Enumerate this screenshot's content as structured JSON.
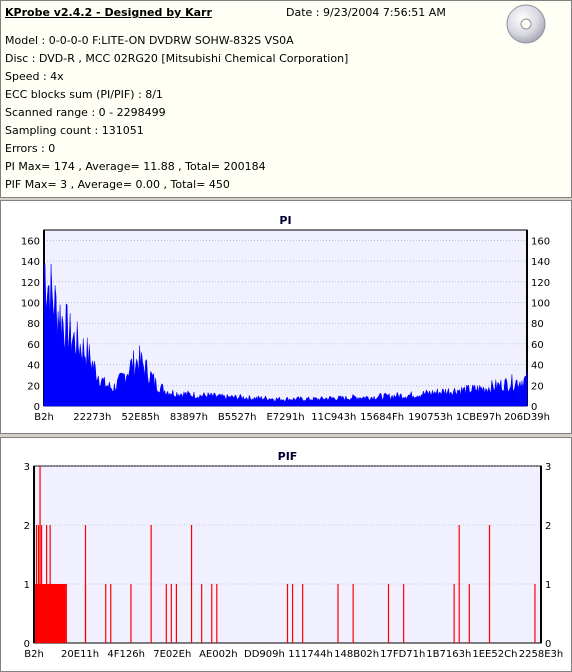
{
  "header": {
    "title": "KProbe v2.4.2 - Designed by Karr",
    "date": "Date : 9/23/2004 7:56:51 AM",
    "lines": [
      "Model : 0-0-0-0 F:LITE-ON DVDRW SOHW-832S  VS0A",
      "Disc : DVD-R , MCC 02RG20  [Mitsubishi Chemical Corporation]",
      "Speed : 4x",
      "ECC blocks sum (PI/PIF) : 8/1",
      "Scanned range : 0 - 2298499",
      "Sampling count : 131051",
      "Errors : 0",
      "PI Max= 174 , Average= 11.88 , Total= 200184",
      "PIF Max= 3 , Average= 0.00 , Total= 450"
    ],
    "icon": "cd-disc-icon"
  },
  "colors": {
    "pi_fill": "#0000ff",
    "pif_bar": "#ff0000",
    "plot_bg": "#f0f0ff",
    "title": "#000033"
  },
  "chart_data": [
    {
      "type": "area",
      "title": "PI",
      "ylim": [
        0,
        170
      ],
      "y_ticks": [
        "0",
        "20",
        "40",
        "60",
        "80",
        "100",
        "120",
        "140",
        "160"
      ],
      "x_ticks": [
        "B2h",
        "22273h",
        "52E85h",
        "83897h",
        "B5527h",
        "E7291h",
        "11C943h",
        "15684Fh",
        "190753h",
        "1CBE97h",
        "206D39h"
      ],
      "x_range_hex": [
        "0",
        "2298499"
      ],
      "envelope_x": [
        "B2h",
        "22273h",
        "52E85h",
        "83897h",
        "B5527h",
        "E7291h",
        "11C943h",
        "15684Fh",
        "190753h",
        "1CBE97h",
        "206D39h",
        "2298499"
      ],
      "envelope_y": [
        160,
        90,
        50,
        14,
        10,
        8,
        9,
        7,
        12,
        17,
        22,
        30
      ],
      "series": [
        {
          "values": [
            160,
            120,
            100,
            80,
            70,
            60,
            40,
            25,
            20,
            30,
            45,
            52,
            40,
            25,
            18,
            15,
            14,
            13,
            12,
            12,
            11,
            10,
            10,
            10,
            9,
            9,
            9,
            8,
            8,
            8,
            8,
            8,
            8,
            9,
            9,
            9,
            10,
            10,
            10,
            11,
            11,
            12,
            12,
            13,
            14,
            15,
            16,
            17,
            18,
            18,
            19,
            20,
            22,
            24,
            26,
            28,
            30
          ]
        }
      ]
    },
    {
      "type": "bar",
      "title": "PIF",
      "ylim": [
        0,
        3
      ],
      "y_ticks": [
        "0",
        "1",
        "2",
        "3"
      ],
      "x_ticks": [
        "B2h",
        "20E11h",
        "4F126h",
        "7E02Eh",
        "AE002h",
        "DD909h",
        "111744h",
        "148B02h",
        "17FD71h",
        "1B7163h",
        "1EE52Ch",
        "2258E3h"
      ],
      "series": [
        {
          "name": "PIF",
          "x_frac": [
            0.003,
            0.007,
            0.01,
            0.013,
            0.017,
            0.02,
            0.023,
            0.027,
            0.03,
            0.033,
            0.036,
            0.04,
            0.043,
            0.046,
            0.05,
            0.053,
            0.056,
            0.06,
            0.062,
            0.1,
            0.1,
            0.14,
            0.15,
            0.19,
            0.23,
            0.26,
            0.27,
            0.28,
            0.31,
            0.33,
            0.35,
            0.36,
            0.5,
            0.51,
            0.53,
            0.6,
            0.63,
            0.7,
            0.73,
            0.83,
            0.84,
            0.86,
            0.9,
            0.99
          ],
          "values": [
            2,
            2,
            3,
            2,
            1,
            1,
            2,
            1,
            2,
            1,
            1,
            1,
            1,
            1,
            1,
            1,
            1,
            1,
            1,
            1,
            2,
            1,
            1,
            1,
            2,
            1,
            1,
            1,
            2,
            1,
            1,
            1,
            1,
            1,
            1,
            1,
            1,
            1,
            1,
            1,
            2,
            1,
            2,
            1
          ]
        }
      ]
    }
  ]
}
